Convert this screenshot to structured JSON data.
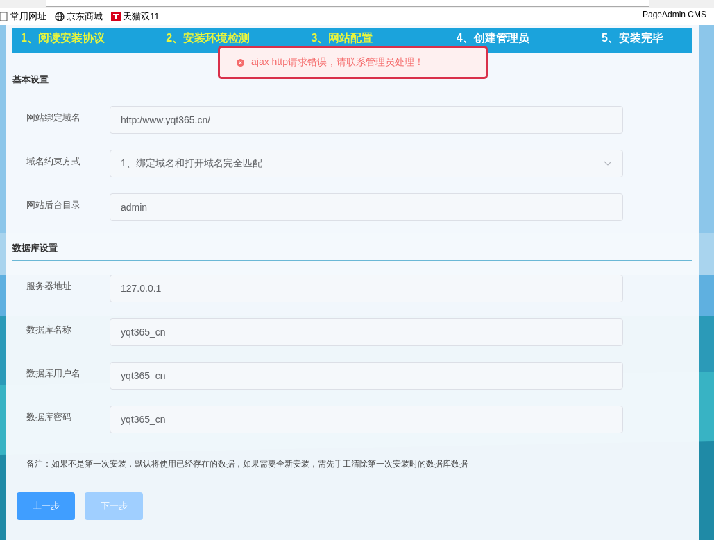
{
  "browser": {
    "bookmarks": [
      {
        "label": "常用网址"
      },
      {
        "label": "京东商城"
      },
      {
        "label": "天猫双11"
      }
    ],
    "extension_label": "PageAdmin CMS"
  },
  "steps": [
    {
      "label": "1、阅读安装协议",
      "completed": true
    },
    {
      "label": "2、安装环境检测",
      "completed": true
    },
    {
      "label": "3、网站配置",
      "completed": true
    },
    {
      "label": "4、创建管理员",
      "completed": false
    },
    {
      "label": "5、安装完毕",
      "completed": false
    }
  ],
  "toast": {
    "kind": "error",
    "message": "ajax http请求错误，请联系管理员处理！"
  },
  "sections": [
    {
      "title": "基本设置",
      "fields": [
        {
          "label": "网站绑定域名",
          "kind": "input",
          "value": "http:/www.yqt365.cn/"
        },
        {
          "label": "域名约束方式",
          "kind": "select",
          "value": "1、绑定域名和打开域名完全匹配"
        },
        {
          "label": "网站后台目录",
          "kind": "input",
          "value": "admin"
        }
      ]
    },
    {
      "title": "数据库设置",
      "fields": [
        {
          "label": "服务器地址",
          "kind": "input",
          "value": "127.0.0.1"
        },
        {
          "label": "数据库名称",
          "kind": "input",
          "value": "yqt365_cn"
        },
        {
          "label": "数据库用户名",
          "kind": "input",
          "value": "yqt365_cn"
        },
        {
          "label": "数据库密码",
          "kind": "input",
          "value": "yqt365_cn"
        }
      ]
    }
  ],
  "note": "备注：如果不是第一次安装，默认将使用已经存在的数据，如果需要全新安装，需先手工清除第一次安装时的数据库数据",
  "buttons": [
    {
      "label": "上一步",
      "disabled": false
    },
    {
      "label": "下一步",
      "disabled": true
    }
  ]
}
